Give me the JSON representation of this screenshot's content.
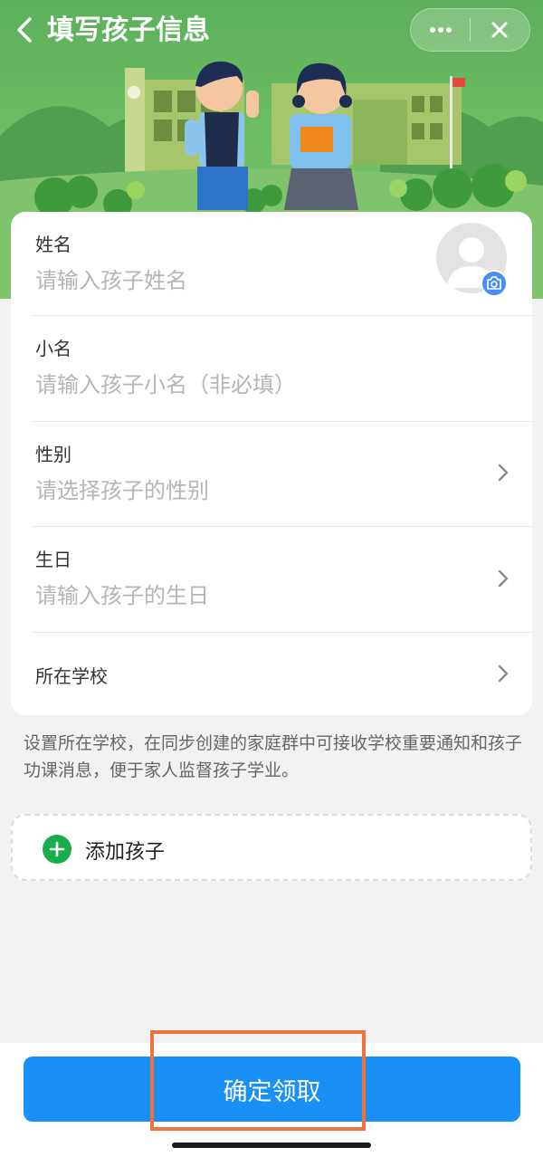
{
  "header": {
    "title": "填写孩子信息",
    "back_icon": "chevron-left-icon",
    "more_icon": "more-dots-icon",
    "close_icon": "close-icon"
  },
  "form": {
    "name": {
      "label": "姓名",
      "placeholder": "请输入孩子姓名"
    },
    "nickname": {
      "label": "小名",
      "placeholder": "请输入孩子小名（非必填）"
    },
    "gender": {
      "label": "性别",
      "placeholder": "请选择孩子的性别"
    },
    "birthday": {
      "label": "生日",
      "placeholder": "请输入孩子的生日"
    },
    "school": {
      "label": "所在学校"
    },
    "avatar_icon": "avatar-placeholder-icon",
    "camera_icon": "camera-icon"
  },
  "hint": "设置所在学校，在同步创建的家庭群中可接收学校重要通知和孩子功课消息，便于家人监督孩子学业。",
  "add_child": {
    "label": "添加孩子",
    "icon": "plus-circle-icon"
  },
  "confirm_button": "确定领取",
  "colors": {
    "banner_green": "#5cb05a",
    "primary_blue": "#1890f5",
    "add_green": "#1aad4b",
    "highlight_orange": "#f0723c"
  }
}
